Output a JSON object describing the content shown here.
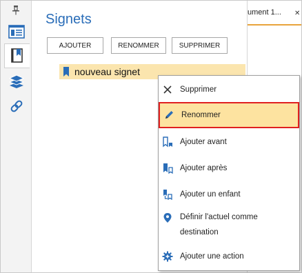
{
  "panel": {
    "title": "Signets",
    "buttons": {
      "add": "AJOUTER",
      "rename": "RENOMMER",
      "delete": "SUPPRIMER"
    },
    "bookmark_item": "nouveau signet"
  },
  "document_tab": {
    "label": "ument 1...",
    "close": "✕"
  },
  "context_menu": {
    "items": [
      {
        "label": "Supprimer",
        "icon": "close-icon"
      },
      {
        "label": "Renommer",
        "icon": "pencil-icon",
        "highlighted": true
      },
      {
        "label": "Ajouter avant",
        "icon": "bookmark-add-before-icon"
      },
      {
        "label": "Ajouter après",
        "icon": "bookmark-add-after-icon"
      },
      {
        "label": "Ajouter un enfant",
        "icon": "bookmark-add-child-icon"
      },
      {
        "label_line1": "Définir l'actuel comme",
        "label_line2": "destination",
        "icon": "location-pin-icon"
      },
      {
        "label": "Ajouter une action",
        "icon": "gear-icon"
      }
    ]
  },
  "colors": {
    "accent_blue": "#2a6db8",
    "highlight": "#fde3a0",
    "highlight_border": "#e02020",
    "selection": "#fbe5ae"
  }
}
